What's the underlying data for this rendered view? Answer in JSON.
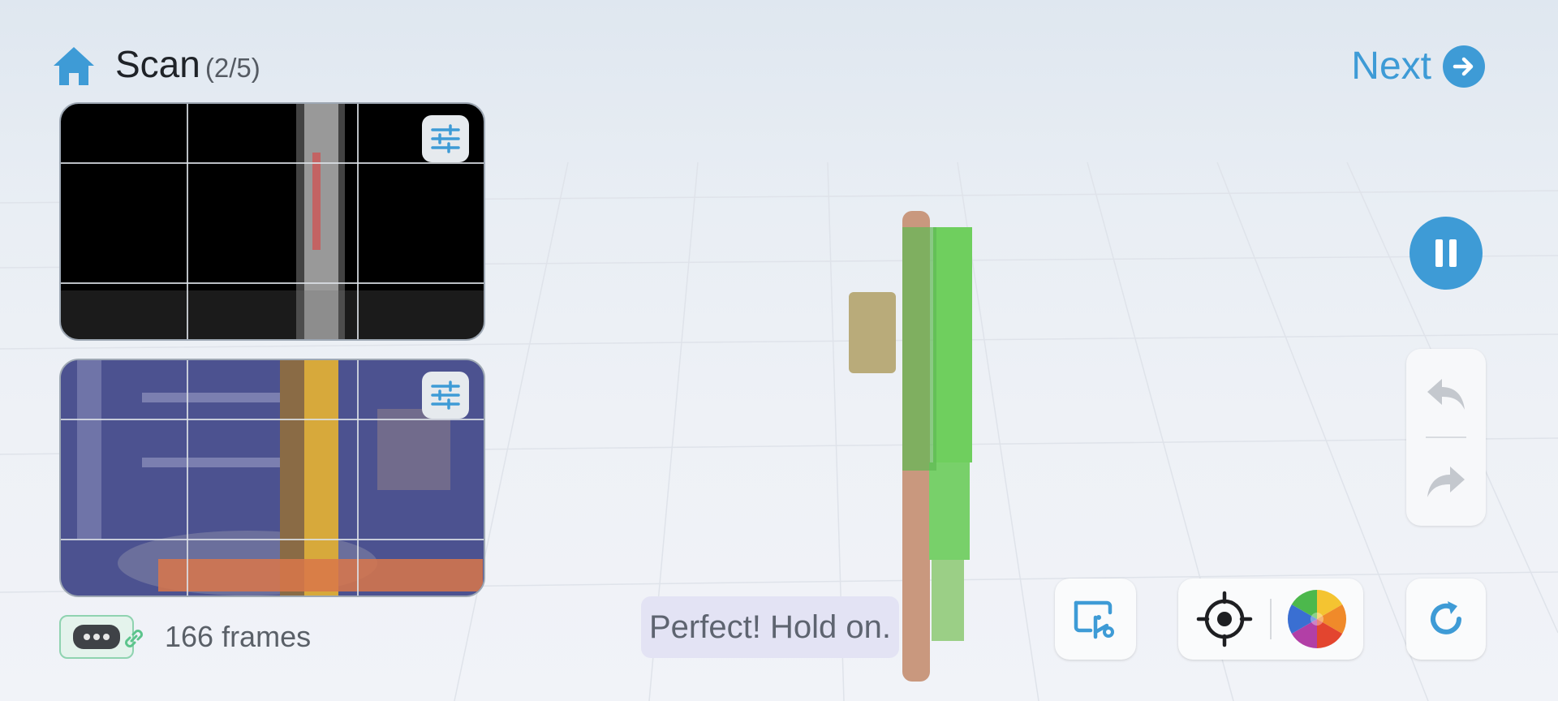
{
  "header": {
    "title": "Scan",
    "progress": "(2/5)",
    "next_label": "Next"
  },
  "panels": {
    "depth": {
      "name": "depth-preview"
    },
    "color": {
      "name": "color-preview"
    }
  },
  "status": {
    "frames_text": "166 frames",
    "message": "Perfect! Hold on."
  },
  "colors": {
    "accent": "#3e9bd6",
    "model_green": "#6fcf5e",
    "link_green": "#5cc48c"
  },
  "icons": [
    "home-icon",
    "arrow-right-icon",
    "sliders-icon",
    "pause-icon",
    "undo-icon",
    "redo-icon",
    "crop-icon",
    "target-icon",
    "color-wheel-icon",
    "refresh-icon",
    "link-icon",
    "scanner-device-icon"
  ]
}
